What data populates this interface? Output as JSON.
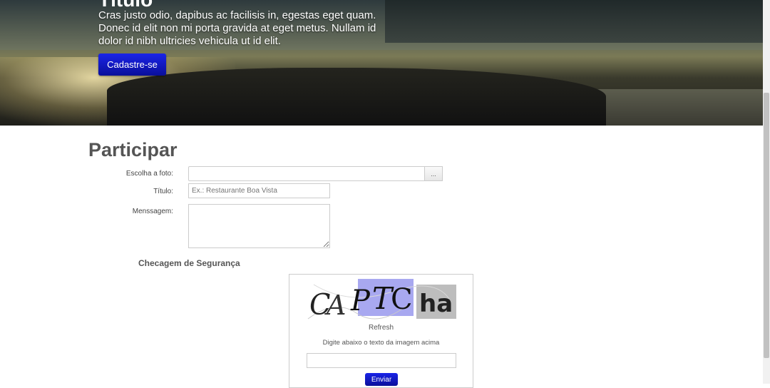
{
  "hero": {
    "title": "Título",
    "text": "Cras justo odio, dapibus ac facilisis in, egestas eget quam. Donec id elit non mi porta gravida at eget metus. Nullam id dolor id nibh ultricies vehicula ut id elit.",
    "button_label": "Cadastre-se"
  },
  "form": {
    "title": "Participar",
    "photo_label": "Escolha a foto:",
    "browse_label": "...",
    "title_label": "Título:",
    "title_placeholder": "Ex.: Restaurante Boa Vista",
    "message_label": "Menssagem:"
  },
  "captcha": {
    "heading": "Checagem de Segurança",
    "image_text": "CAPTCha",
    "refresh_label": "Refresh",
    "instruction": "Digite abaixo o texto da imagem acima",
    "submit_label": "Enviar"
  },
  "colors": {
    "button_primary": "#0a12c8"
  }
}
